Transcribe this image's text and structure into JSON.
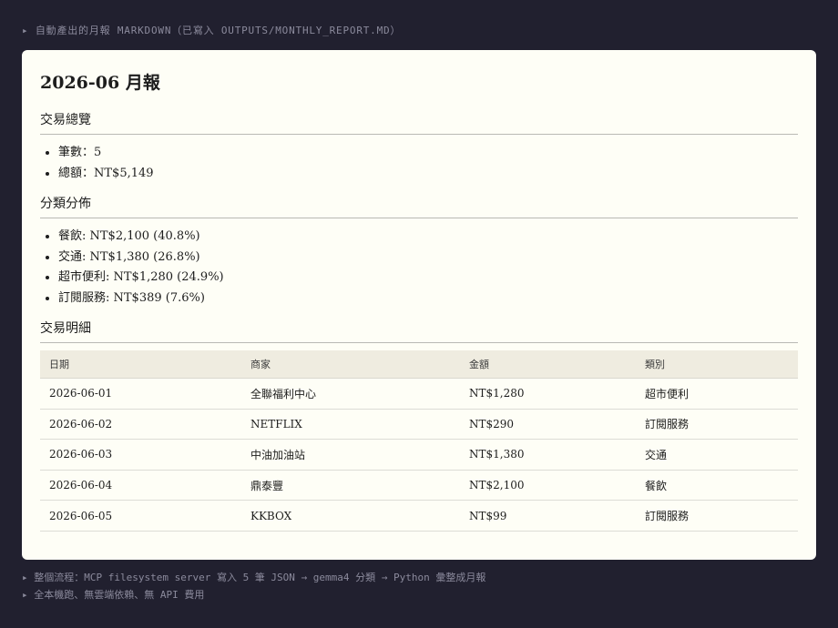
{
  "caption": "▸ 自動產出的月報 MARKDOWN（已寫入 OUTPUTS/MONTHLY_REPORT.MD）",
  "report": {
    "title": "2026-06 月報",
    "overview": {
      "heading": "交易總覽",
      "items": [
        "筆數：5",
        "總額：NT$5,149"
      ]
    },
    "categories": {
      "heading": "分類分佈",
      "items": [
        "餐飲: NT$2,100 (40.8%)",
        "交通: NT$1,380 (26.8%)",
        "超市便利: NT$1,280 (24.9%)",
        "訂閱服務: NT$389 (7.6%)"
      ]
    },
    "details": {
      "heading": "交易明細",
      "columns": [
        "日期",
        "商家",
        "金額",
        "類別"
      ],
      "rows": [
        [
          "2026-06-01",
          "全聯福利中心",
          "NT$1,280",
          "超市便利"
        ],
        [
          "2026-06-02",
          "NETFLIX",
          "NT$290",
          "訂閱服務"
        ],
        [
          "2026-06-03",
          "中油加油站",
          "NT$1,380",
          "交通"
        ],
        [
          "2026-06-04",
          "鼎泰豐",
          "NT$2,100",
          "餐飲"
        ],
        [
          "2026-06-05",
          "KKBOX",
          "NT$99",
          "訂閱服務"
        ]
      ]
    }
  },
  "footer": [
    "▸ 整個流程：MCP filesystem server 寫入 5 筆 JSON → gemma4 分類 → Python 彙整成月報",
    "▸ 全本機跑、無雲端依賴、無 API 費用"
  ]
}
